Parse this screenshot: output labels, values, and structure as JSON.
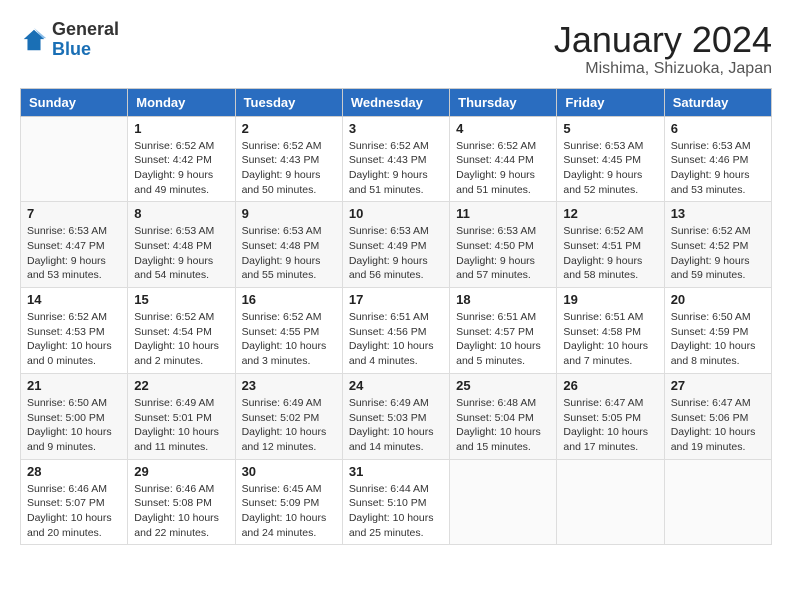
{
  "logo": {
    "general": "General",
    "blue": "Blue"
  },
  "title": "January 2024",
  "location": "Mishima, Shizuoka, Japan",
  "days_of_week": [
    "Sunday",
    "Monday",
    "Tuesday",
    "Wednesday",
    "Thursday",
    "Friday",
    "Saturday"
  ],
  "weeks": [
    [
      {
        "day": "",
        "info": ""
      },
      {
        "day": "1",
        "info": "Sunrise: 6:52 AM\nSunset: 4:42 PM\nDaylight: 9 hours\nand 49 minutes."
      },
      {
        "day": "2",
        "info": "Sunrise: 6:52 AM\nSunset: 4:43 PM\nDaylight: 9 hours\nand 50 minutes."
      },
      {
        "day": "3",
        "info": "Sunrise: 6:52 AM\nSunset: 4:43 PM\nDaylight: 9 hours\nand 51 minutes."
      },
      {
        "day": "4",
        "info": "Sunrise: 6:52 AM\nSunset: 4:44 PM\nDaylight: 9 hours\nand 51 minutes."
      },
      {
        "day": "5",
        "info": "Sunrise: 6:53 AM\nSunset: 4:45 PM\nDaylight: 9 hours\nand 52 minutes."
      },
      {
        "day": "6",
        "info": "Sunrise: 6:53 AM\nSunset: 4:46 PM\nDaylight: 9 hours\nand 53 minutes."
      }
    ],
    [
      {
        "day": "7",
        "info": "Sunrise: 6:53 AM\nSunset: 4:47 PM\nDaylight: 9 hours\nand 53 minutes."
      },
      {
        "day": "8",
        "info": "Sunrise: 6:53 AM\nSunset: 4:48 PM\nDaylight: 9 hours\nand 54 minutes."
      },
      {
        "day": "9",
        "info": "Sunrise: 6:53 AM\nSunset: 4:48 PM\nDaylight: 9 hours\nand 55 minutes."
      },
      {
        "day": "10",
        "info": "Sunrise: 6:53 AM\nSunset: 4:49 PM\nDaylight: 9 hours\nand 56 minutes."
      },
      {
        "day": "11",
        "info": "Sunrise: 6:53 AM\nSunset: 4:50 PM\nDaylight: 9 hours\nand 57 minutes."
      },
      {
        "day": "12",
        "info": "Sunrise: 6:52 AM\nSunset: 4:51 PM\nDaylight: 9 hours\nand 58 minutes."
      },
      {
        "day": "13",
        "info": "Sunrise: 6:52 AM\nSunset: 4:52 PM\nDaylight: 9 hours\nand 59 minutes."
      }
    ],
    [
      {
        "day": "14",
        "info": "Sunrise: 6:52 AM\nSunset: 4:53 PM\nDaylight: 10 hours\nand 0 minutes."
      },
      {
        "day": "15",
        "info": "Sunrise: 6:52 AM\nSunset: 4:54 PM\nDaylight: 10 hours\nand 2 minutes."
      },
      {
        "day": "16",
        "info": "Sunrise: 6:52 AM\nSunset: 4:55 PM\nDaylight: 10 hours\nand 3 minutes."
      },
      {
        "day": "17",
        "info": "Sunrise: 6:51 AM\nSunset: 4:56 PM\nDaylight: 10 hours\nand 4 minutes."
      },
      {
        "day": "18",
        "info": "Sunrise: 6:51 AM\nSunset: 4:57 PM\nDaylight: 10 hours\nand 5 minutes."
      },
      {
        "day": "19",
        "info": "Sunrise: 6:51 AM\nSunset: 4:58 PM\nDaylight: 10 hours\nand 7 minutes."
      },
      {
        "day": "20",
        "info": "Sunrise: 6:50 AM\nSunset: 4:59 PM\nDaylight: 10 hours\nand 8 minutes."
      }
    ],
    [
      {
        "day": "21",
        "info": "Sunrise: 6:50 AM\nSunset: 5:00 PM\nDaylight: 10 hours\nand 9 minutes."
      },
      {
        "day": "22",
        "info": "Sunrise: 6:49 AM\nSunset: 5:01 PM\nDaylight: 10 hours\nand 11 minutes."
      },
      {
        "day": "23",
        "info": "Sunrise: 6:49 AM\nSunset: 5:02 PM\nDaylight: 10 hours\nand 12 minutes."
      },
      {
        "day": "24",
        "info": "Sunrise: 6:49 AM\nSunset: 5:03 PM\nDaylight: 10 hours\nand 14 minutes."
      },
      {
        "day": "25",
        "info": "Sunrise: 6:48 AM\nSunset: 5:04 PM\nDaylight: 10 hours\nand 15 minutes."
      },
      {
        "day": "26",
        "info": "Sunrise: 6:47 AM\nSunset: 5:05 PM\nDaylight: 10 hours\nand 17 minutes."
      },
      {
        "day": "27",
        "info": "Sunrise: 6:47 AM\nSunset: 5:06 PM\nDaylight: 10 hours\nand 19 minutes."
      }
    ],
    [
      {
        "day": "28",
        "info": "Sunrise: 6:46 AM\nSunset: 5:07 PM\nDaylight: 10 hours\nand 20 minutes."
      },
      {
        "day": "29",
        "info": "Sunrise: 6:46 AM\nSunset: 5:08 PM\nDaylight: 10 hours\nand 22 minutes."
      },
      {
        "day": "30",
        "info": "Sunrise: 6:45 AM\nSunset: 5:09 PM\nDaylight: 10 hours\nand 24 minutes."
      },
      {
        "day": "31",
        "info": "Sunrise: 6:44 AM\nSunset: 5:10 PM\nDaylight: 10 hours\nand 25 minutes."
      },
      {
        "day": "",
        "info": ""
      },
      {
        "day": "",
        "info": ""
      },
      {
        "day": "",
        "info": ""
      }
    ]
  ]
}
